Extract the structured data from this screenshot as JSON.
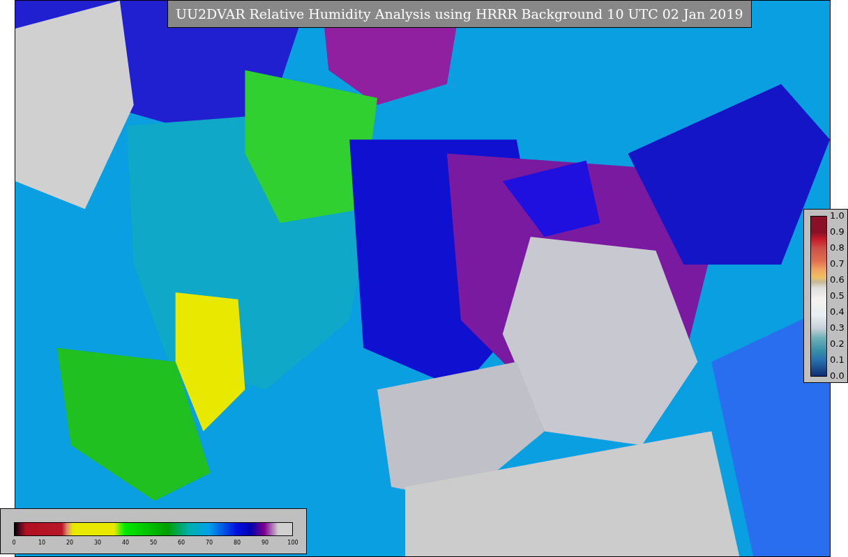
{
  "title": "UU2DVAR Relative Humidity Analysis using HRRR Background 10 UTC 02 Jan 2019",
  "humidity_colorbar": {
    "ticks": [
      "0",
      "10",
      "20",
      "30",
      "40",
      "50",
      "60",
      "70",
      "80",
      "90",
      "100"
    ]
  },
  "observation_colorbar": {
    "ticks": [
      "1.0",
      "0.9",
      "0.8",
      "0.7",
      "0.6",
      "0.5",
      "0.4",
      "0.3",
      "0.2",
      "0.1",
      "0.0"
    ]
  }
}
